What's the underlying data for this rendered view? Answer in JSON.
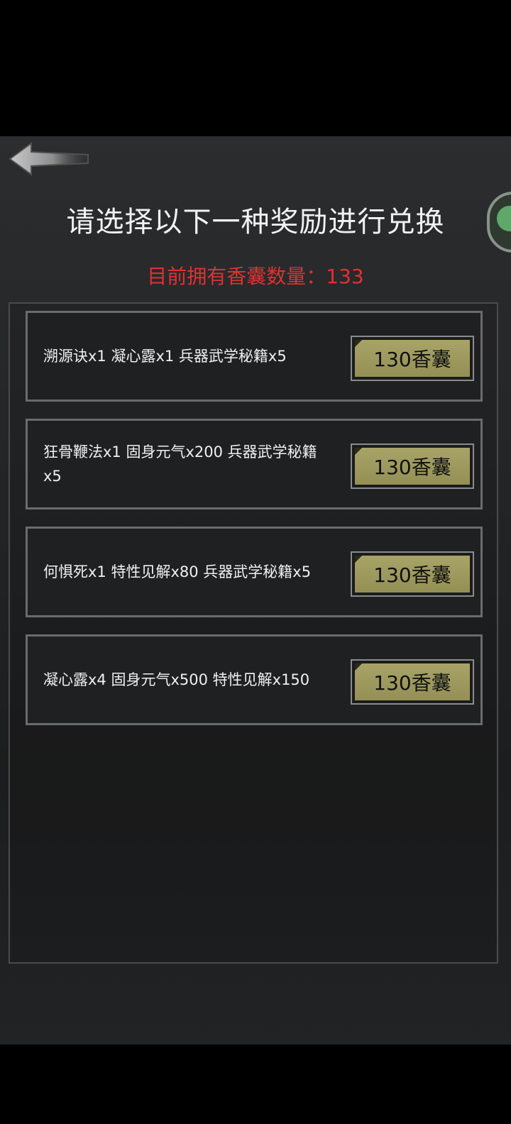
{
  "page": {
    "title": "请选择以下一种奖励进行兑换",
    "count_text": "目前拥有香囊数量：133"
  },
  "icons": {
    "back": "arrow-left-icon",
    "side_badge": "chat-bubble-icon"
  },
  "colors": {
    "title": "#f2f2f2",
    "count": "#e03131",
    "button_face": "#a8a468",
    "card_border": "#6a6b6d"
  },
  "rewards": [
    {
      "text": "溯源诀x1  凝心露x1  兵器武学秘籍x5",
      "button_label": "130香囊"
    },
    {
      "text": "狂骨鞭法x1  固身元气x200  兵器武学秘籍x5",
      "button_label": "130香囊"
    },
    {
      "text": "何惧死x1  特性见解x80  兵器武学秘籍x5",
      "button_label": "130香囊"
    },
    {
      "text": "凝心露x4  固身元气x500  特性见解x150",
      "button_label": "130香囊"
    }
  ]
}
